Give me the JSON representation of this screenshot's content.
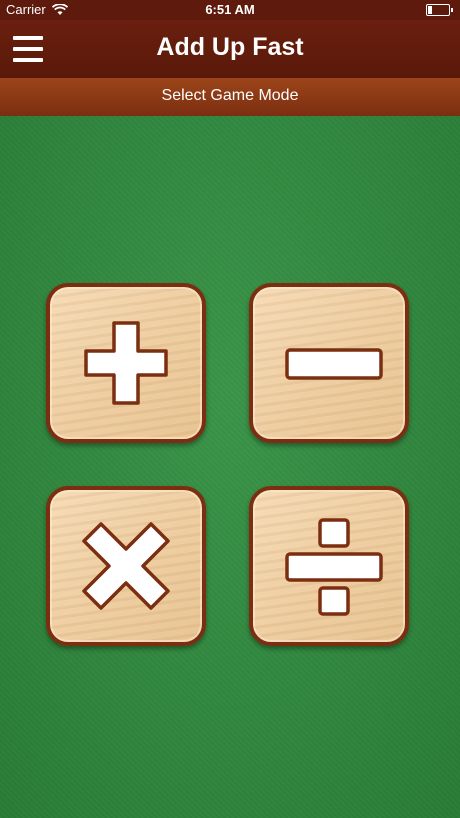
{
  "status_bar": {
    "carrier": "Carrier",
    "time": "6:51 AM"
  },
  "nav_bar": {
    "title": "Add Up Fast"
  },
  "sub_bar": {
    "title": "Select Game Mode"
  },
  "modes": [
    {
      "icon": "plus-icon"
    },
    {
      "icon": "minus-icon"
    },
    {
      "icon": "multiply-icon"
    },
    {
      "icon": "divide-icon"
    }
  ],
  "colors": {
    "nav_bar": "#641d0d",
    "sub_bar": "#8c3a15",
    "felt": "#2e8d3d",
    "tile_border": "#7b2f10",
    "tile_wood": "#f2d4aa"
  }
}
